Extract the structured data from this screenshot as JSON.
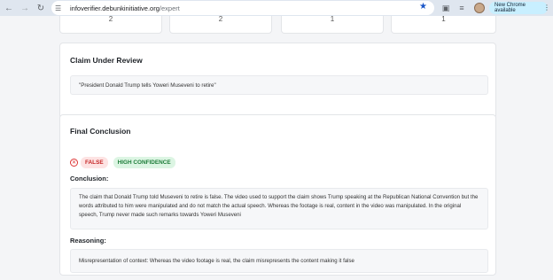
{
  "browser": {
    "url_host": "infoverifier.debunkinitiative.org",
    "url_path": "/expert",
    "new_chrome_label": "New Chrome available"
  },
  "stats": [
    "2",
    "2",
    "1",
    "1"
  ],
  "claim_card": {
    "title": "Claim Under Review",
    "claim": "\"President Donald Trump tells Yoweri Museveni to retire\""
  },
  "conclusion_card": {
    "title": "Final Conclusion",
    "verdict": "FALSE",
    "confidence": "HIGH CONFIDENCE",
    "conclusion_label": "Conclusion:",
    "conclusion_text": "The claim that Donald Trump told Museveni to retire is false. The video used to support the claim shows Trump speaking at the Republican National Convention but the words attributed to him were manipulated and do not match the actual speech. Whereas the footage is real, content in the video was manipulated. In the original speech, Trump never made such remarks towards Yoweri Museveni",
    "reasoning_label": "Reasoning:",
    "reasoning_text": "Misrepresentation of context: Whereas the video footage is real, the claim misrepresents the content making it false"
  },
  "icons": {
    "back": "arrow-left-icon",
    "forward": "arrow-right-icon",
    "reload": "reload-icon",
    "site_settings": "tune-icon",
    "bookmark": "star-icon",
    "verdict": "x-circle-icon"
  },
  "colors": {
    "false_badge": "#c62828",
    "confidence_badge": "#1e7d3a",
    "bookmark_star": "#1a56c8"
  }
}
